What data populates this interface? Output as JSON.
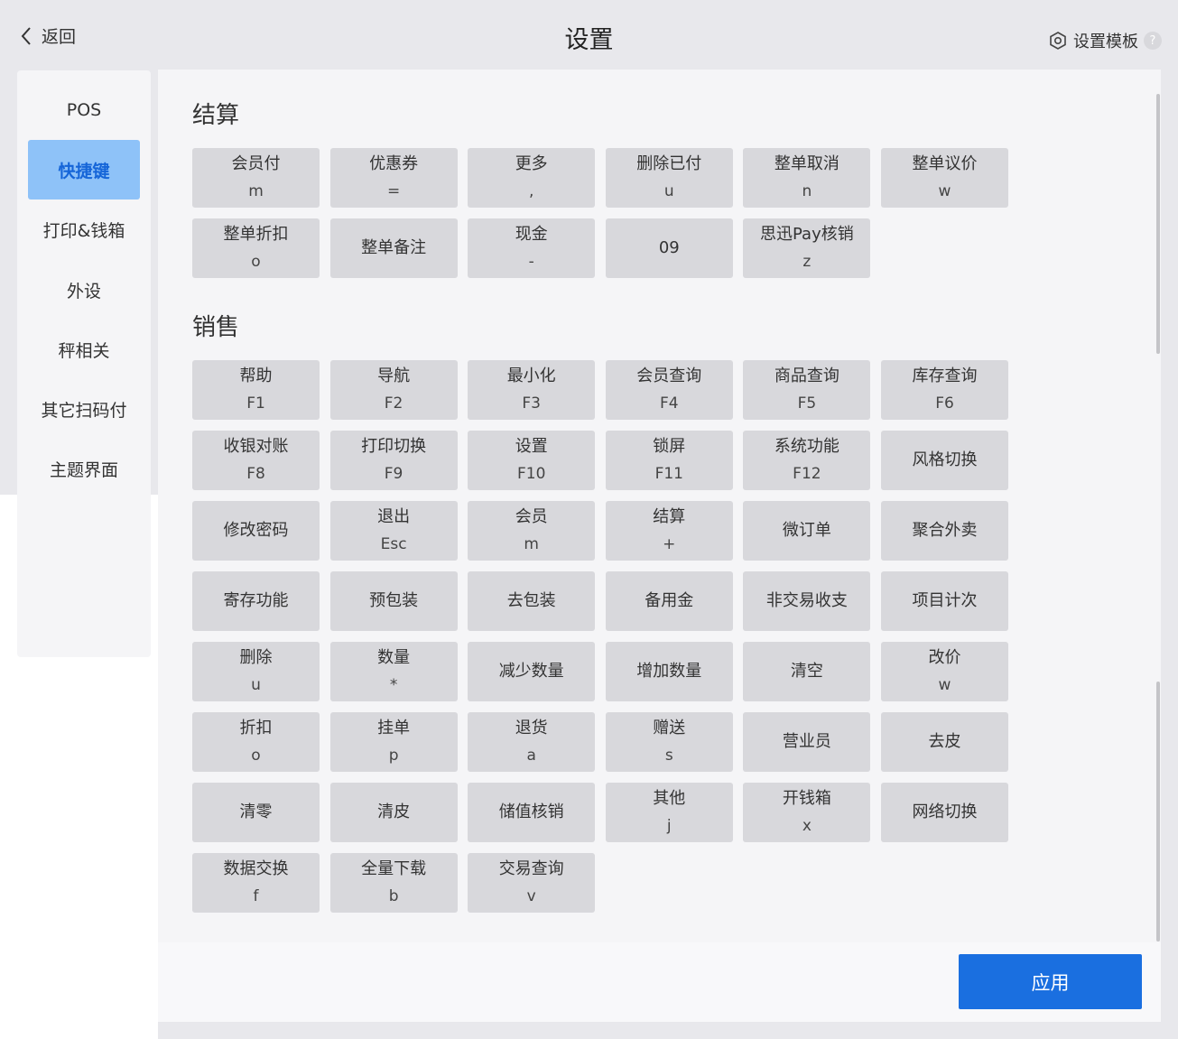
{
  "header": {
    "back_label": "返回",
    "title": "设置",
    "template_label": "设置模板",
    "help_mark": "?"
  },
  "sidebar": {
    "items": [
      {
        "label": "POS",
        "active": false
      },
      {
        "label": "快捷键",
        "active": true
      },
      {
        "label": "打印&钱箱",
        "active": false
      },
      {
        "label": "外设",
        "active": false
      },
      {
        "label": "秤相关",
        "active": false
      },
      {
        "label": "其它扫码付",
        "active": false
      },
      {
        "label": "主题界面",
        "active": false
      }
    ]
  },
  "sections": {
    "checkout": {
      "title": "结算",
      "keys": [
        {
          "label": "会员付",
          "key": "m"
        },
        {
          "label": "优惠券",
          "key": "="
        },
        {
          "label": "更多",
          "key": ","
        },
        {
          "label": "删除已付",
          "key": "u"
        },
        {
          "label": "整单取消",
          "key": "n"
        },
        {
          "label": "整单议价",
          "key": "w"
        },
        {
          "label": "整单折扣",
          "key": "o"
        },
        {
          "label": "整单备注",
          "key": ""
        },
        {
          "label": "现金",
          "key": "-"
        },
        {
          "label": "09",
          "key": ""
        },
        {
          "label": "思迅Pay核销",
          "key": "z"
        }
      ]
    },
    "sales": {
      "title": "销售",
      "keys": [
        {
          "label": "帮助",
          "key": "F1"
        },
        {
          "label": "导航",
          "key": "F2"
        },
        {
          "label": "最小化",
          "key": "F3"
        },
        {
          "label": "会员查询",
          "key": "F4"
        },
        {
          "label": "商品查询",
          "key": "F5"
        },
        {
          "label": "库存查询",
          "key": "F6"
        },
        {
          "label": "收银对账",
          "key": "F8"
        },
        {
          "label": "打印切换",
          "key": "F9"
        },
        {
          "label": "设置",
          "key": "F10"
        },
        {
          "label": "锁屏",
          "key": "F11"
        },
        {
          "label": "系统功能",
          "key": "F12"
        },
        {
          "label": "风格切换",
          "key": ""
        },
        {
          "label": "修改密码",
          "key": ""
        },
        {
          "label": "退出",
          "key": "Esc"
        },
        {
          "label": "会员",
          "key": "m"
        },
        {
          "label": "结算",
          "key": "+"
        },
        {
          "label": "微订单",
          "key": ""
        },
        {
          "label": "聚合外卖",
          "key": ""
        },
        {
          "label": "寄存功能",
          "key": ""
        },
        {
          "label": "预包装",
          "key": ""
        },
        {
          "label": "去包装",
          "key": ""
        },
        {
          "label": "备用金",
          "key": ""
        },
        {
          "label": "非交易收支",
          "key": ""
        },
        {
          "label": "项目计次",
          "key": ""
        },
        {
          "label": "删除",
          "key": "u"
        },
        {
          "label": "数量",
          "key": "*"
        },
        {
          "label": "减少数量",
          "key": ""
        },
        {
          "label": "增加数量",
          "key": ""
        },
        {
          "label": "清空",
          "key": ""
        },
        {
          "label": "改价",
          "key": "w"
        },
        {
          "label": "折扣",
          "key": "o"
        },
        {
          "label": "挂单",
          "key": "p"
        },
        {
          "label": "退货",
          "key": "a"
        },
        {
          "label": "赠送",
          "key": "s"
        },
        {
          "label": "营业员",
          "key": ""
        },
        {
          "label": "去皮",
          "key": ""
        },
        {
          "label": "清零",
          "key": ""
        },
        {
          "label": "清皮",
          "key": ""
        },
        {
          "label": "储值核销",
          "key": ""
        },
        {
          "label": "其他",
          "key": "j"
        },
        {
          "label": "开钱箱",
          "key": "x"
        },
        {
          "label": "网络切换",
          "key": ""
        },
        {
          "label": "数据交换",
          "key": "f"
        },
        {
          "label": "全量下载",
          "key": "b"
        },
        {
          "label": "交易查询",
          "key": "v"
        }
      ]
    }
  },
  "footer": {
    "apply_label": "应用"
  },
  "colors": {
    "accent": "#1a6fe0",
    "active_bg": "#8ec2f8",
    "key_bg": "#d8d8dc"
  }
}
